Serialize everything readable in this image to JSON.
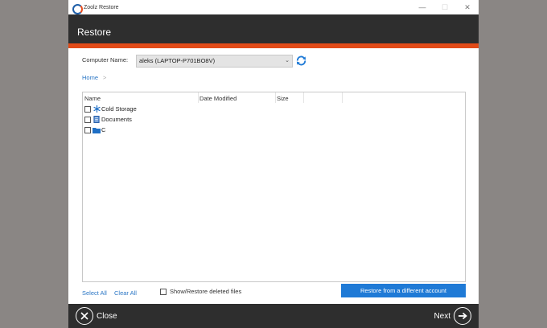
{
  "window": {
    "title": "Zoolz Restore",
    "minimize": "—",
    "maximize": "☐",
    "close": "✕"
  },
  "header": {
    "title": "Restore"
  },
  "computer": {
    "label": "Computer Name:",
    "selected": "aleks (LAPTOP-P701BO8V)"
  },
  "breadcrumb": {
    "home": "Home",
    "separator": ">"
  },
  "table": {
    "columns": [
      "Name",
      "Date Modified",
      "Size"
    ],
    "rows": [
      {
        "name": "Cold Storage",
        "icon": "snowflake-icon"
      },
      {
        "name": "Documents",
        "icon": "document-icon"
      },
      {
        "name": "C",
        "icon": "folder-icon"
      }
    ]
  },
  "actions": {
    "select_all": "Select All",
    "clear_all": "Clear All",
    "show_deleted": "Show/Restore deleted files",
    "restore_different": "Restore from a different account"
  },
  "footer": {
    "close_label": "Close",
    "next_label": "Next"
  },
  "colors": {
    "accent": "#e14b18",
    "header_bg": "#2e2e2e",
    "primary_button": "#1f7ad6",
    "link": "#2a76c5"
  }
}
